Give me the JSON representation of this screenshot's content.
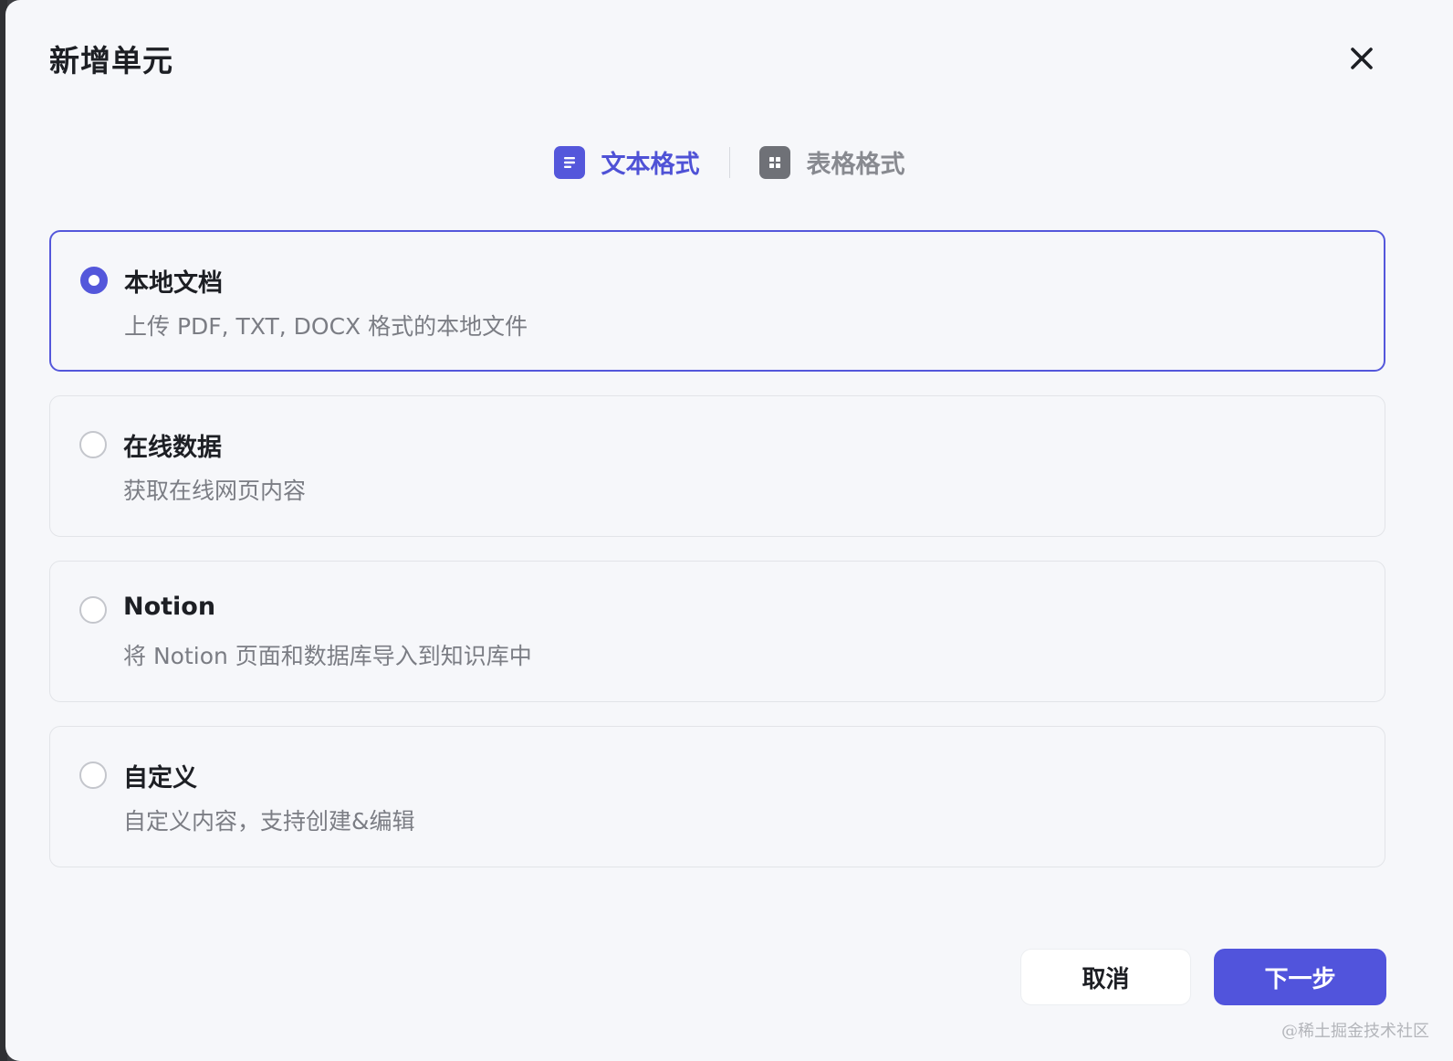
{
  "dialog": {
    "title": "新增单元",
    "close_icon": "close-icon"
  },
  "tabs": [
    {
      "label": "文本格式",
      "icon": "document-icon",
      "active": true
    },
    {
      "label": "表格格式",
      "icon": "table-icon",
      "active": false
    }
  ],
  "options": [
    {
      "title": "本地文档",
      "description": "上传 PDF, TXT, DOCX 格式的本地文件",
      "selected": true
    },
    {
      "title": "在线数据",
      "description": "获取在线网页内容",
      "selected": false
    },
    {
      "title": "Notion",
      "description": "将 Notion 页面和数据库导入到知识库中",
      "selected": false
    },
    {
      "title": "自定义",
      "description": "自定义内容，支持创建&编辑",
      "selected": false
    }
  ],
  "footer": {
    "cancel_label": "取消",
    "next_label": "下一步"
  },
  "watermark": "@稀土掘金技术社区",
  "colors": {
    "accent": "#5457db",
    "background": "#f6f7fa"
  }
}
